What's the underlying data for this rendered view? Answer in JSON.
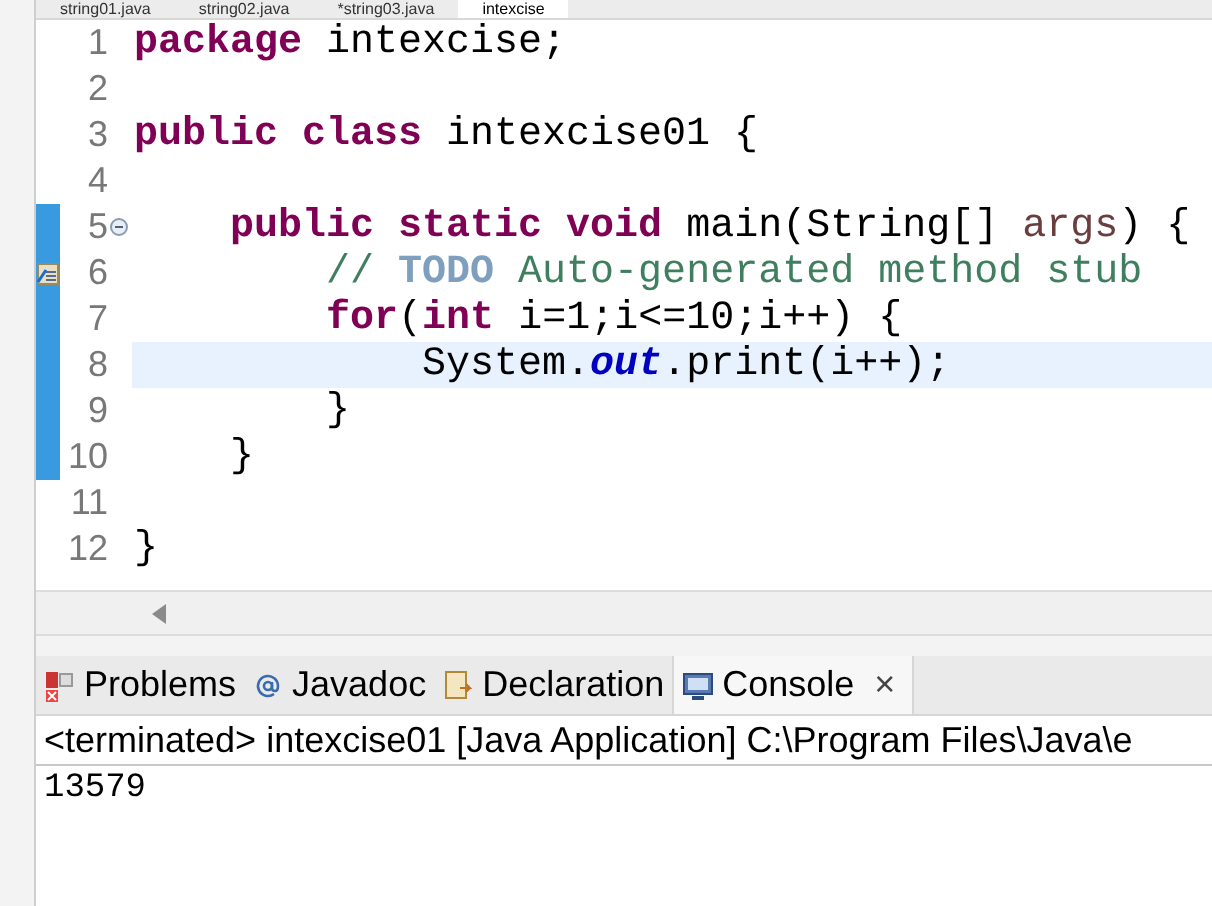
{
  "editor_tabs": [
    {
      "label": "string01.java",
      "selected": false
    },
    {
      "label": "string02.java",
      "selected": false
    },
    {
      "label": "*string03.java",
      "selected": false
    },
    {
      "label": "intexcise",
      "selected": true
    }
  ],
  "code_lines": [
    {
      "number": "1",
      "current": false,
      "changed": false,
      "tokens": [
        {
          "kind": "keyword",
          "text": "package"
        },
        {
          "kind": "plain",
          "text": " intexcise;"
        }
      ]
    },
    {
      "number": "2",
      "current": false,
      "changed": false
    },
    {
      "number": "3",
      "current": false,
      "changed": false,
      "tokens": [
        {
          "kind": "keyword",
          "text": "public"
        },
        {
          "kind": "keyword",
          "text": " class"
        },
        {
          "kind": "plain",
          "text": " intexcise01 {"
        }
      ]
    },
    {
      "number": "4",
      "current": false,
      "changed": false
    },
    {
      "number": "5",
      "current": false,
      "changed": true,
      "fold": true,
      "tokens": [
        {
          "kind": "keyword",
          "text": "    public"
        },
        {
          "kind": "keyword",
          "text": " static"
        },
        {
          "kind": "keyword",
          "text": " void"
        },
        {
          "kind": "plain",
          "text": " main(String[] "
        },
        {
          "kind": "param",
          "text": "args"
        },
        {
          "kind": "plain",
          "text": ") {"
        }
      ]
    },
    {
      "number": "6",
      "current": false,
      "changed": true,
      "task": true,
      "tokens": [
        {
          "kind": "comment",
          "text": "        // "
        },
        {
          "kind": "todo",
          "text": "TODO"
        },
        {
          "kind": "comment",
          "text": " Auto-generated method stub"
        }
      ]
    },
    {
      "number": "7",
      "current": false,
      "changed": true,
      "tokens": [
        {
          "kind": "keyword",
          "text": "        for"
        },
        {
          "kind": "plain",
          "text": "("
        },
        {
          "kind": "keyword",
          "text": "int"
        },
        {
          "kind": "plain",
          "text": " i=1;i<=10;i++) {"
        }
      ]
    },
    {
      "number": "8",
      "current": true,
      "changed": true,
      "tokens": [
        {
          "kind": "plain",
          "text": "            System."
        },
        {
          "kind": "field",
          "text": "out"
        },
        {
          "kind": "plain",
          "text": ".print(i++);"
        }
      ]
    },
    {
      "number": "9",
      "current": false,
      "changed": true,
      "tokens": [
        {
          "kind": "plain",
          "text": "        }"
        }
      ]
    },
    {
      "number": "10",
      "current": false,
      "changed": true,
      "tokens": [
        {
          "kind": "plain",
          "text": "    }"
        }
      ]
    },
    {
      "number": "11",
      "current": false,
      "changed": false
    },
    {
      "number": "12",
      "current": false,
      "changed": false,
      "tokens": [
        {
          "kind": "plain",
          "text": "}"
        }
      ]
    }
  ],
  "view_tabs": [
    {
      "label": "Problems",
      "kind": "problems",
      "selected": false
    },
    {
      "label": "Javadoc",
      "kind": "javadoc",
      "selected": false
    },
    {
      "label": "Declaration",
      "kind": "declaration",
      "selected": false
    },
    {
      "label": "Console",
      "kind": "console",
      "selected": true,
      "close": "×"
    }
  ],
  "console": {
    "header": "<terminated> intexcise01 [Java Application] C:\\Program Files\\Java\\e",
    "output": "13579"
  }
}
